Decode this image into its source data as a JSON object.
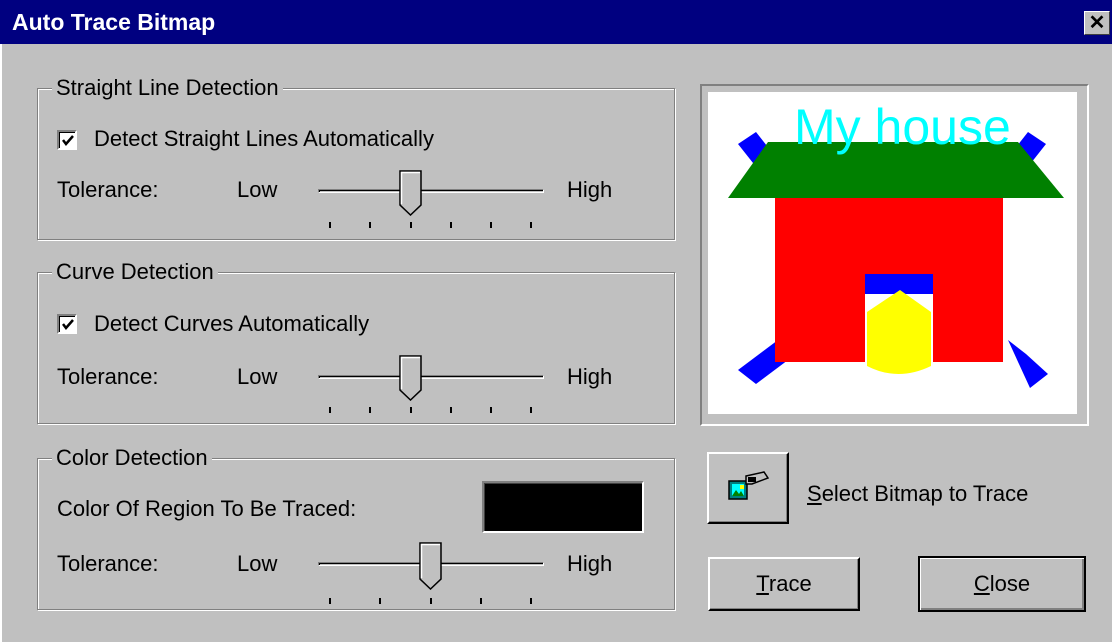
{
  "window": {
    "title": "Auto Trace Bitmap",
    "close_glyph": "✕"
  },
  "straight": {
    "group_title": "Straight Line Detection",
    "checkbox_label": "Detect Straight Lines Automatically",
    "checked": true,
    "tolerance_label": "Tolerance:",
    "low_label": "Low",
    "high_label": "High",
    "slider_value": 0.4
  },
  "curve": {
    "group_title": "Curve Detection",
    "checkbox_label": "Detect Curves Automatically",
    "checked": true,
    "tolerance_label": "Tolerance:",
    "low_label": "Low",
    "high_label": "High",
    "slider_value": 0.4
  },
  "color": {
    "group_title": "Color Detection",
    "region_label": "Color Of Region To Be Traced:",
    "swatch_color": "#000000",
    "tolerance_label": "Tolerance:",
    "low_label": "Low",
    "high_label": "High",
    "slider_value": 0.5
  },
  "preview": {
    "caption": "My house",
    "colors": {
      "roof": "#008000",
      "walls": "#ff0000",
      "rays": "#0000ff",
      "sun": "#ffff00",
      "text": "#00ffff"
    }
  },
  "select_bitmap": {
    "mnemonic": "S",
    "label_rest": "elect Bitmap to Trace",
    "icon": "bitmap-select-icon"
  },
  "buttons": {
    "trace": {
      "mnemonic": "T",
      "rest": "race"
    },
    "close": {
      "mnemonic": "C",
      "rest": "lose"
    }
  }
}
